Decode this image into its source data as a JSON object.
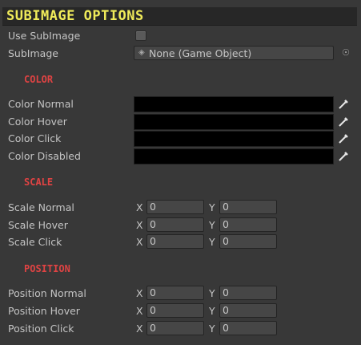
{
  "header": {
    "title": "SUBIMAGE OPTIONS"
  },
  "subimage": {
    "use_label": "Use SubImage",
    "use_checked": false,
    "field_label": "SubImage",
    "field_value": "None (Game Object)",
    "field_icon": "gameobject-icon",
    "picker_icon": "object-picker-icon"
  },
  "color_section": {
    "title": "COLOR",
    "rows": [
      {
        "label": "Color Normal",
        "color": "#000000"
      },
      {
        "label": "Color Hover",
        "color": "#000000"
      },
      {
        "label": "Color Click",
        "color": "#000000"
      },
      {
        "label": "Color Disabled",
        "color": "#000000"
      }
    ]
  },
  "scale_section": {
    "title": "SCALE",
    "rows": [
      {
        "label": "Scale Normal",
        "x_label": "X",
        "x": "0",
        "y_label": "Y",
        "y": "0"
      },
      {
        "label": "Scale Hover",
        "x_label": "X",
        "x": "0",
        "y_label": "Y",
        "y": "0"
      },
      {
        "label": "Scale Click",
        "x_label": "X",
        "x": "0",
        "y_label": "Y",
        "y": "0"
      }
    ]
  },
  "position_section": {
    "title": "POSITION",
    "rows": [
      {
        "label": "Position Normal",
        "x_label": "X",
        "x": "0",
        "y_label": "Y",
        "y": "0"
      },
      {
        "label": "Position Hover",
        "x_label": "X",
        "x": "0",
        "y_label": "Y",
        "y": "0"
      },
      {
        "label": "Position Click",
        "x_label": "X",
        "x": "0",
        "y_label": "Y",
        "y": "0"
      }
    ]
  },
  "colors": {
    "header_text": "#f0eb5a",
    "section_text": "#e04343"
  }
}
